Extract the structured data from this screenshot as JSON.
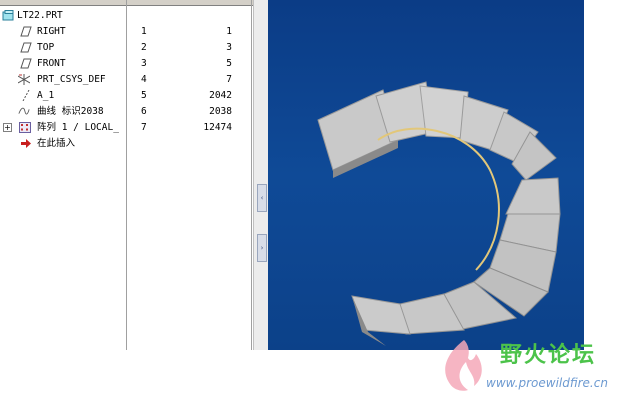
{
  "model_tree": {
    "root_label": "LT22.PRT",
    "items": [
      {
        "label": "RIGHT",
        "num": "1",
        "id": "1",
        "icon": "datum-plane-icon"
      },
      {
        "label": "TOP",
        "num": "2",
        "id": "3",
        "icon": "datum-plane-icon"
      },
      {
        "label": "FRONT",
        "num": "3",
        "id": "5",
        "icon": "datum-plane-icon"
      },
      {
        "label": "PRT_CSYS_DEF",
        "num": "4",
        "id": "7",
        "icon": "csys-icon"
      },
      {
        "label": "A_1",
        "num": "5",
        "id": "2042",
        "icon": "axis-icon"
      },
      {
        "label": "曲线 标识2038",
        "num": "6",
        "id": "2038",
        "icon": "curve-icon"
      },
      {
        "label": "阵列 1 / LOCAL_",
        "num": "7",
        "id": "12474",
        "icon": "pattern-icon"
      },
      {
        "label": "在此插入",
        "num": "",
        "id": "",
        "icon": "insert-arrow-icon"
      }
    ]
  },
  "splitter": {
    "collapse_glyph": "‹",
    "expand_glyph": "›"
  },
  "watermark": {
    "title": "野火论坛",
    "url": "www.proewildfire.cn"
  },
  "colors": {
    "viewport_bg": "#0f4a97",
    "step_face": "#c8c8c8",
    "watermark_green": "#4cc34a"
  }
}
